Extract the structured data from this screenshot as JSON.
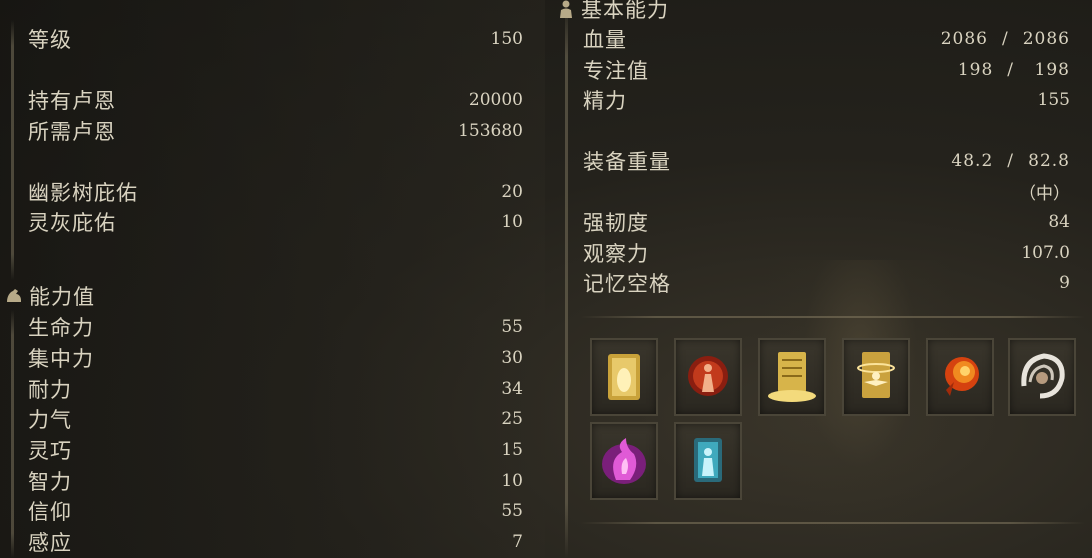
{
  "left": {
    "level": {
      "label": "等级",
      "value": "150"
    },
    "runes_held": {
      "label": "持有卢恩",
      "value": "20000"
    },
    "runes_needed": {
      "label": "所需卢恩",
      "value": "153680"
    },
    "scadutree_blessing": {
      "label": "幽影树庇佑",
      "value": "20"
    },
    "ash_blessing": {
      "label": "灵灰庇佑",
      "value": "10"
    },
    "attributes": {
      "title": "能力值",
      "icon": "flexed-arm-icon",
      "items": [
        {
          "label": "生命力",
          "value": "55"
        },
        {
          "label": "集中力",
          "value": "30"
        },
        {
          "label": "耐力",
          "value": "34"
        },
        {
          "label": "力气",
          "value": "25"
        },
        {
          "label": "灵巧",
          "value": "15"
        },
        {
          "label": "智力",
          "value": "10"
        },
        {
          "label": "信仰",
          "value": "55"
        },
        {
          "label": "感应",
          "value": "7"
        }
      ]
    }
  },
  "right": {
    "base_stats": {
      "title": "基本能力",
      "icon": "body-silhouette-icon",
      "hp": {
        "label": "血量",
        "current": "2086",
        "sep": "/",
        "max": "2086"
      },
      "fp": {
        "label": "专注值",
        "current": "198",
        "sep": "/",
        "max": "198"
      },
      "stamina": {
        "label": "精力",
        "value": "155"
      },
      "equip_load": {
        "label": "装备重量",
        "current": "48.2",
        "sep": "/",
        "max": "82.8",
        "status": "（中）"
      },
      "poise": {
        "label": "强韧度",
        "value": "84"
      },
      "discovery": {
        "label": "观察力",
        "value": "107.0"
      },
      "memory_slots": {
        "label": "记忆空格",
        "value": "9"
      }
    },
    "spells": [
      {
        "icon": "golden-incantation-icon"
      },
      {
        "icon": "red-flame-figure-icon"
      },
      {
        "icon": "golden-tablet-icon"
      },
      {
        "icon": "golden-blessing-icon"
      },
      {
        "icon": "fireball-icon"
      },
      {
        "icon": "white-swirl-icon"
      },
      {
        "icon": "pink-flame-icon"
      },
      {
        "icon": "blue-ghost-icon"
      }
    ]
  },
  "colors": {
    "text": "#d9d3c0",
    "bg": "#24221c",
    "slot": "#3a362c"
  }
}
